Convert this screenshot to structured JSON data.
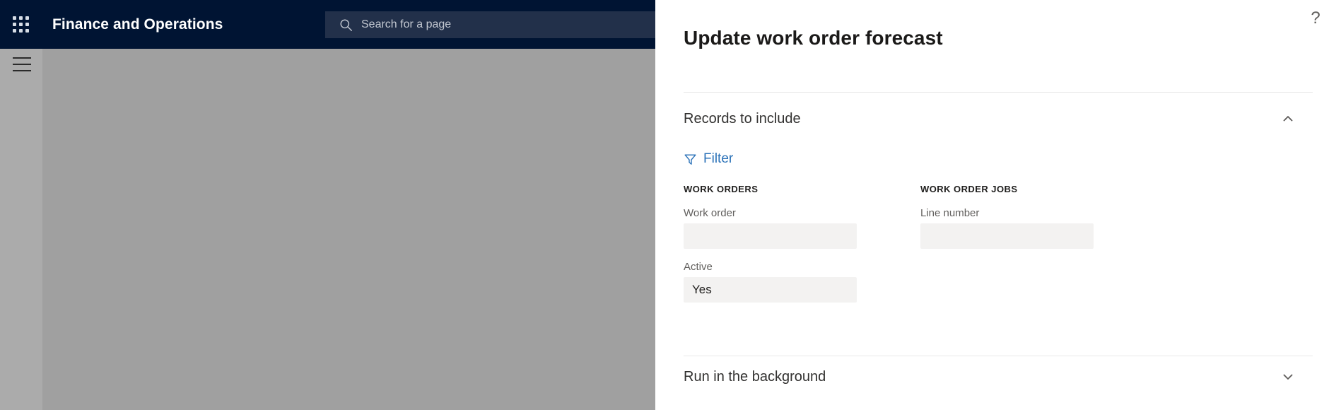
{
  "topbar": {
    "app_launcher_icon": "waffle-grid-icon",
    "app_title": "Finance and Operations",
    "search": {
      "icon": "search-icon",
      "placeholder": "Search for a page",
      "value": ""
    }
  },
  "navrail": {
    "menu_icon": "hamburger-icon"
  },
  "panel": {
    "help_icon": "question-mark-icon",
    "help_label": "?",
    "title": "Update work order forecast",
    "sections": {
      "records": {
        "label": "Records to include",
        "expanded": true,
        "chevron_icon": "chevron-up-icon",
        "filter": {
          "icon": "funnel-icon",
          "label": "Filter"
        },
        "groups": [
          {
            "title": "WORK ORDERS",
            "fields": [
              {
                "label": "Work order",
                "value": "",
                "placeholder": ""
              },
              {
                "label": "Active",
                "value": "Yes",
                "placeholder": ""
              }
            ]
          },
          {
            "title": "WORK ORDER JOBS",
            "fields": [
              {
                "label": "Line number",
                "value": "",
                "placeholder": ""
              }
            ]
          }
        ]
      },
      "background": {
        "label": "Run in the background",
        "expanded": false,
        "chevron_icon": "chevron-down-icon"
      }
    }
  },
  "colors": {
    "topbar_bg": "#001433",
    "search_bg": "#22304a",
    "panel_bg": "#ffffff",
    "accent_link": "#2b72b8",
    "input_bg": "#f3f2f1",
    "dim_overlay": "#a0a0a0",
    "navrail_bg": "#ababab",
    "divider": "#e8e8e8"
  }
}
